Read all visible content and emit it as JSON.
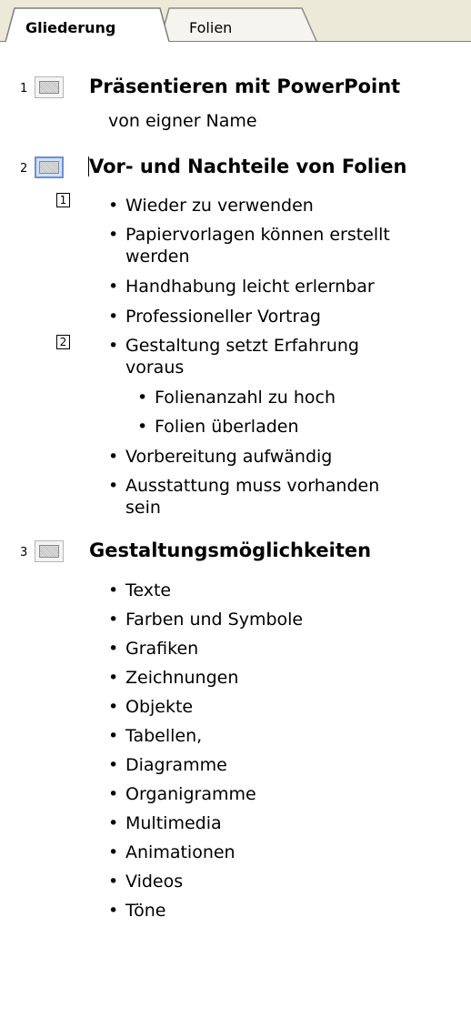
{
  "tabs": {
    "outline_label": "Gliederung",
    "slides_label": "Folien"
  },
  "slides": [
    {
      "number": "1",
      "title": "Präsentieren mit PowerPoint",
      "subtitle": "von eigner Name"
    },
    {
      "number": "2",
      "title": "Vor- und Nachteile von Folien",
      "anim_badges": [
        "1",
        "2"
      ],
      "bullets": [
        {
          "text": "Wieder zu verwenden"
        },
        {
          "text": "Papiervorlagen können erstellt",
          "text2": "werden"
        },
        {
          "text": "Handhabung leicht erlernbar"
        },
        {
          "text": "Professioneller Vortrag"
        },
        {
          "text": "Gestaltung setzt Erfahrung",
          "text2": "voraus"
        },
        {
          "text": "Folienanzahl zu hoch"
        },
        {
          "text": "Folien überladen"
        },
        {
          "text": "Vorbereitung aufwändig"
        },
        {
          "text": "Ausstattung muss vorhanden",
          "text2": "sein"
        }
      ]
    },
    {
      "number": "3",
      "title": "Gestaltungsmöglichkeiten",
      "bullets": [
        {
          "text": "Texte"
        },
        {
          "text": "Farben und Symbole"
        },
        {
          "text": "Grafiken"
        },
        {
          "text": "Zeichnungen"
        },
        {
          "text": "Objekte"
        },
        {
          "text": "Tabellen,"
        },
        {
          "text": "Diagramme"
        },
        {
          "text": "Organigramme"
        },
        {
          "text": "Multimedia"
        },
        {
          "text": "Animationen"
        },
        {
          "text": "Videos"
        },
        {
          "text": "Töne"
        }
      ]
    }
  ],
  "bullet_glyph": "•",
  "colors": {
    "tab_strip": "#ece9d8",
    "selected_slide_icon_border": "#6f8fd6",
    "selected_slide_icon_fill": "#cfe0fb"
  }
}
